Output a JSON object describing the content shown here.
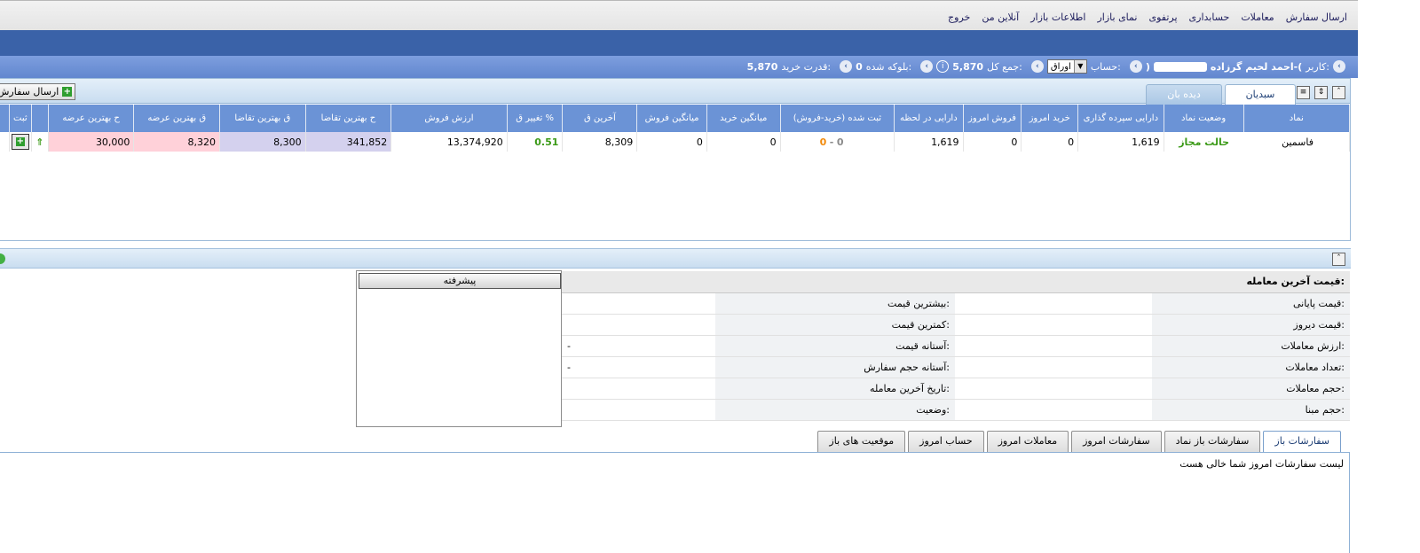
{
  "top_nav": [
    "ارسال سفارش",
    "معاملات",
    "حسابداری",
    "پرتفوی",
    "نمای بازار",
    "اطلاعات بازار",
    "آنلاین من",
    "خروج"
  ],
  "info": {
    "user_label": "کاربر:",
    "user_name": "احمد لحیم گرزاده-(",
    "user_close": ")",
    "account_label": "حساب:",
    "account_value": "اوراق",
    "total_label": "جمع کل:",
    "total_value": "5,870",
    "blocked_label": "بلوکه شده:",
    "blocked_value": "0",
    "power_label": "قدرت خرید:",
    "power_value": "5,870"
  },
  "watch": {
    "send_button": "ارسال سفارش",
    "tabs": [
      "سبدیان",
      "دیده بان"
    ],
    "columns": [
      "نماد",
      "وضعیت نماد",
      "دارایی سپرده گذاری",
      "خرید امروز",
      "فروش امروز",
      "دارایی در لحظه",
      "ثبت شده (خرید-فروش)",
      "میانگین خرید",
      "میانگین فروش",
      "آخرین ق",
      "تغییر ق %",
      "ارزش فروش",
      "ح بهترین تقاضا",
      "ق بهترین تقاضا",
      "ق بهترین عرضه",
      "ح بهترین عرضه",
      "",
      "ثبت"
    ],
    "row": {
      "symbol": "فاسمین",
      "status": "حالت مجاز",
      "deposit_asset": "1,619",
      "buy_today": "0",
      "sell_today": "0",
      "live_asset": "1,619",
      "registered_buy": "0",
      "registered_sep": "-",
      "registered_sell": "0",
      "avg_buy": "0",
      "avg_sell": "0",
      "last_price": "8,309",
      "change_pct": "0.51",
      "sell_value": "13,374,920",
      "bid_volume": "341,852",
      "bid_price": "8,300",
      "ask_price": "8,320",
      "ask_volume": "30,000"
    }
  },
  "detail": {
    "advanced_button": "پیشرفته",
    "header": "قیمت آخرین معامله:",
    "left": [
      "قیمت پایانی:",
      "قیمت دیروز:",
      "ارزش معاملات:",
      "تعداد معاملات:",
      "حجم معاملات:",
      "حجم مبنا:"
    ],
    "right": [
      "بیشترین قیمت:",
      "کمترین قیمت:",
      "آستانه قیمت:",
      "آستانه حجم سفارش:",
      "تاریخ آخرین معامله:",
      "وضعیت:"
    ],
    "right_values": [
      "",
      "",
      "-",
      "-",
      "",
      ""
    ]
  },
  "orders": {
    "tabs": [
      "سفارشات باز",
      "سفارشات باز نماد",
      "سفارشات امروز",
      "معاملات امروز",
      "حساب امروز",
      "موقعیت های باز"
    ],
    "empty_message": "لیست سفارشات امروز شما خالی هست"
  }
}
